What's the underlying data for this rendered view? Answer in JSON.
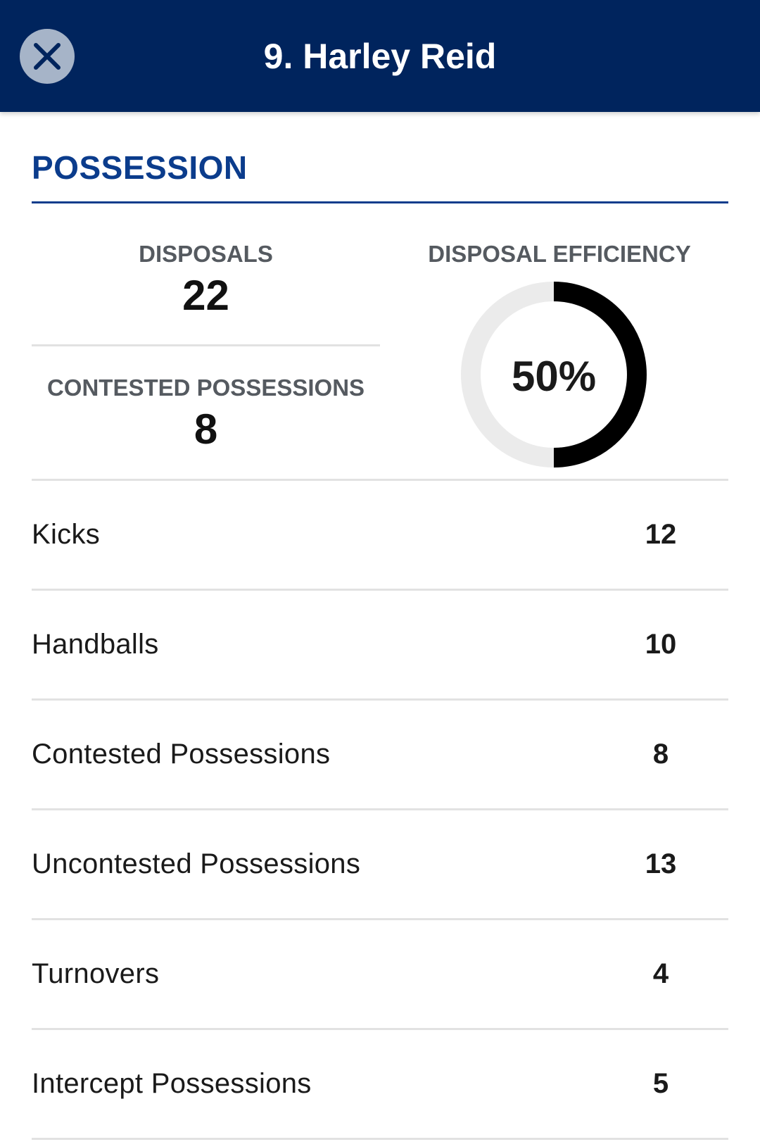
{
  "header": {
    "title": "9. Harley Reid",
    "close_icon": "close-icon",
    "background_color": "#00245d"
  },
  "section": {
    "title": "POSSESSION",
    "accent_color": "#0b3c8c"
  },
  "summary": {
    "disposals_label": "DISPOSALS",
    "disposals_value": "22",
    "contested_label": "CONTESTED POSSESSIONS",
    "contested_value": "8",
    "efficiency_label": "DISPOSAL EFFICIENCY",
    "efficiency_text": "50%",
    "efficiency_fraction": 0.5
  },
  "stats": [
    {
      "label": "Kicks",
      "value": "12"
    },
    {
      "label": "Handballs",
      "value": "10"
    },
    {
      "label": "Contested Possessions",
      "value": "8"
    },
    {
      "label": "Uncontested Possessions",
      "value": "13"
    },
    {
      "label": "Turnovers",
      "value": "4"
    },
    {
      "label": "Intercept Possessions",
      "value": "5"
    }
  ]
}
